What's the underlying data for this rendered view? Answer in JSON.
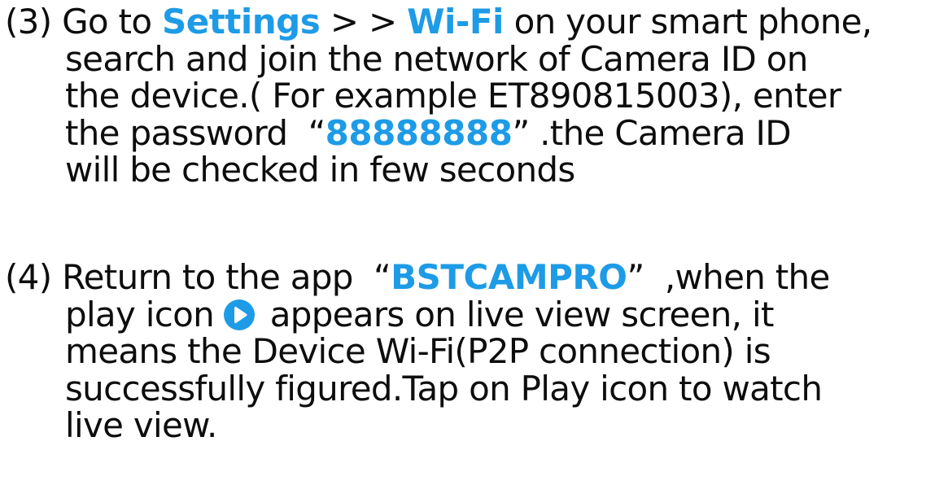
{
  "step3": {
    "number": "(3)",
    "line1": {
      "prefix": "Go to ",
      "settings": "Settings",
      "separator": " > > ",
      "wifi": "Wi-Fi",
      "suffix": " on your smart phone,"
    },
    "line2": "search and join the network of Camera ID on",
    "line3": "the device.( For example ET890815003), enter",
    "line4": {
      "prefix": "the password  “",
      "password": "88888888",
      "suffix": "” .the Camera ID"
    },
    "line5": "will be checked in few seconds"
  },
  "step4": {
    "number": "(4)",
    "line1": {
      "prefix": "Return to the app  “",
      "app_name": "BSTCAMPRO",
      "suffix": "”  ,when the"
    },
    "line2": {
      "prefix": "play icon",
      "suffix": " appears on live view screen, it"
    },
    "line3": "means the Device Wi-Fi(P2P connection) is",
    "line4": "successfully figured.Tap on Play icon to watch",
    "line5": "live view."
  },
  "icons": {
    "play": "play-circle-icon"
  },
  "colors": {
    "text": "#0d0d0d",
    "highlight": "#1e9be6",
    "background": "#ffffff"
  }
}
